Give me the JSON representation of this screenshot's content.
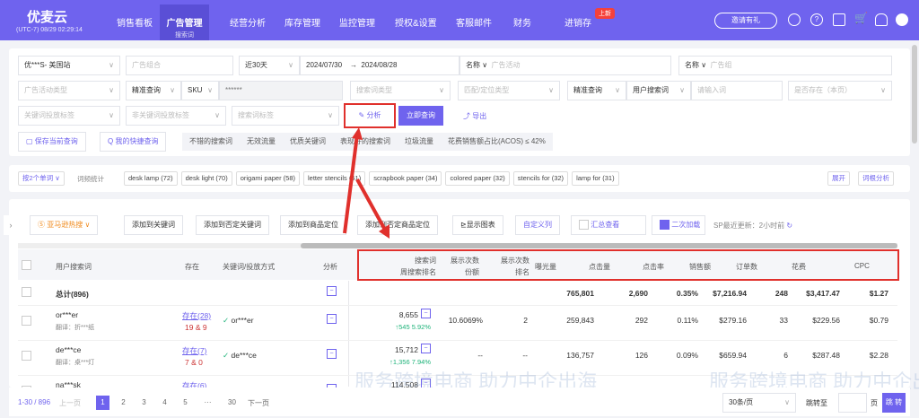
{
  "nav": {
    "logo": "优麦云",
    "timezone": "(UTC-7) 08/29 02:29:14",
    "items": [
      "销售看板",
      "广告管理",
      "经营分析",
      "库存管理",
      "监控管理",
      "授权&设置",
      "客服邮件",
      "财务",
      "进销存"
    ],
    "active_sub": "搜索词",
    "badge": "上新",
    "invite": "邀请有礼"
  },
  "filters": {
    "shop": "优***S- 美国站",
    "ad_group_ph": "广告组合",
    "range": "近30天",
    "start": "2024/07/30",
    "end": "2024/08/28",
    "name1": "名称",
    "campaign_ph": "广告活动",
    "name2": "名称",
    "adgroup_ph": "广告组",
    "campaign_type_ph": "广告活动类型",
    "precise1": "精准查询",
    "sku": "SKU",
    "sku_value": "******",
    "search_type_ph": "搜索词类型",
    "match_type_ph": "匹配/定位类型",
    "precise2": "精准查询",
    "user_search": "用户搜索词",
    "input_ph": "请输入词",
    "exists_ph": "是否存在（本页）",
    "kw_tag_ph": "关键词投放标签",
    "nonkw_tag_ph": "非关键词投放标签",
    "search_tag_ph": "搜索词标签",
    "analyze": "分析",
    "query": "立即查询",
    "export": "导出",
    "save": "保存当前查询",
    "quick": "我的快捷查询",
    "tags": [
      "不错的搜索词",
      "无效流量",
      "优质关键词",
      "表现好的搜索词",
      "垃圾流量",
      "花费销售额占比(ACOS) ≤ 42%"
    ]
  },
  "wordstats": {
    "mode": "按2个单词",
    "label": "词频统计",
    "chips": [
      "desk lamp (72)",
      "desk light (70)",
      "origami paper (58)",
      "letter stencils (51)",
      "scrapbook paper (34)",
      "colored paper (32)",
      "stencils for (32)",
      "lamp for (31)"
    ],
    "expand": "展开",
    "root": "词根分析"
  },
  "toolbar": {
    "hot": "亚马逊热搜",
    "buttons": [
      "添加到关键词",
      "添加到否定关键词",
      "添加到商品定位",
      "添加到否定商品定位",
      "显示图表"
    ],
    "custom": "自定义列",
    "summary": "汇总查看",
    "secondary": "二次加载",
    "update": "SP最近更新：2小时前"
  },
  "table": {
    "headers": {
      "term": "用户搜索词",
      "exists": "存在",
      "kw": "关键词/投放方式",
      "analysis": "分析",
      "rank1": "搜索词",
      "rank2": "周搜索排名",
      "share1": "展示次数",
      "share2": "份额",
      "srank1": "展示次数",
      "srank2": "排名",
      "impr": "曝光量",
      "clicks": "点击量",
      "ctr": "点击率",
      "sales": "销售额",
      "orders": "订单数",
      "spend": "花费",
      "cpc": "CPC"
    },
    "total": {
      "label": "总计(896)",
      "impr": "765,801",
      "clicks": "2,690",
      "ctr": "0.35%",
      "sales": "$7,216.94",
      "orders": "248",
      "spend": "$3,417.47",
      "cpc": "$1.27"
    },
    "rows": [
      {
        "term": "or***er",
        "trans": "翻译：折***纸",
        "exists": "存在(28)",
        "counts": "19 & 9",
        "kw": "or***er",
        "rank": "8,655",
        "delta": "↑545  5.92%",
        "share": "10.6069%",
        "srank": "2",
        "impr": "259,843",
        "clicks": "292",
        "ctr": "0.11%",
        "sales": "$279.16",
        "orders": "33",
        "spend": "$229.56",
        "cpc": "$0.79"
      },
      {
        "term": "de***ce",
        "trans": "翻译：桌***灯",
        "exists": "存在(7)",
        "counts": "7 & 0",
        "kw": "de***ce",
        "rank": "15,712",
        "delta": "↑1,356  7.94%",
        "share": "--",
        "srank": "--",
        "impr": "136,757",
        "clicks": "126",
        "ctr": "0.09%",
        "sales": "$659.94",
        "orders": "6",
        "spend": "$287.48",
        "cpc": "$2.28"
      },
      {
        "term": "na***sk",
        "trans": "",
        "exists": "存在(6)",
        "counts": "",
        "kw": "",
        "rank": "114,508",
        "delta": "",
        "share": "",
        "srank": "",
        "impr": "",
        "clicks": "",
        "ctr": "",
        "sales": "",
        "orders": "",
        "spend": "",
        "cpc": ""
      }
    ]
  },
  "pagination": {
    "range": "1-30 / 896",
    "prev": "上一页",
    "pages": [
      "1",
      "2",
      "3",
      "4",
      "5",
      "···",
      "30"
    ],
    "next": "下一页",
    "per": "30条/页",
    "goto": "跳转至",
    "page": "页",
    "go": "跳 转"
  },
  "watermark": {
    "text": "服务跨境电商 助力中企出海"
  },
  "colors": {
    "primary": "#6f63ee",
    "highlight": "#e0302c",
    "up": "#1fb37a"
  }
}
